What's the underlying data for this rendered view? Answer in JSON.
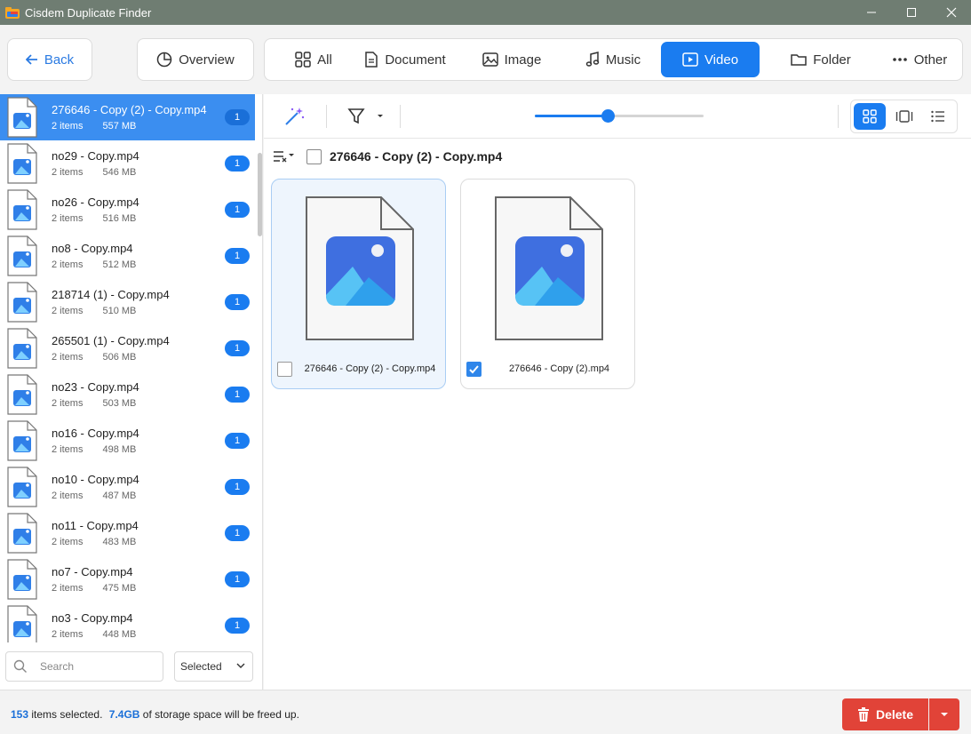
{
  "window": {
    "title": "Cisdem Duplicate Finder"
  },
  "nav": {
    "back_label": "Back",
    "overview_label": "Overview",
    "tabs": [
      {
        "label": "All",
        "icon": "grid-icon"
      },
      {
        "label": "Document",
        "icon": "document-icon"
      },
      {
        "label": "Image",
        "icon": "image-icon"
      },
      {
        "label": "Music",
        "icon": "music-note-icon"
      },
      {
        "label": "Video",
        "icon": "video-icon",
        "active": true
      },
      {
        "label": "Folder",
        "icon": "folder-icon"
      },
      {
        "label": "Other",
        "icon": "more-dots-icon"
      }
    ]
  },
  "sidebar": {
    "items": [
      {
        "name": "276646 - Copy (2) - Copy.mp4",
        "count_text": "2 items",
        "size": "557 MB",
        "badge": "1",
        "selected": true
      },
      {
        "name": "no29 - Copy.mp4",
        "count_text": "2 items",
        "size": "546 MB",
        "badge": "1"
      },
      {
        "name": "no26 - Copy.mp4",
        "count_text": "2 items",
        "size": "516 MB",
        "badge": "1"
      },
      {
        "name": "no8 - Copy.mp4",
        "count_text": "2 items",
        "size": "512 MB",
        "badge": "1"
      },
      {
        "name": "218714 (1) - Copy.mp4",
        "count_text": "2 items",
        "size": "510 MB",
        "badge": "1"
      },
      {
        "name": "265501 (1) - Copy.mp4",
        "count_text": "2 items",
        "size": "506 MB",
        "badge": "1"
      },
      {
        "name": "no23 - Copy.mp4",
        "count_text": "2 items",
        "size": "503 MB",
        "badge": "1"
      },
      {
        "name": "no16 - Copy.mp4",
        "count_text": "2 items",
        "size": "498 MB",
        "badge": "1"
      },
      {
        "name": "no10 - Copy.mp4",
        "count_text": "2 items",
        "size": "487 MB",
        "badge": "1"
      },
      {
        "name": "no11 - Copy.mp4",
        "count_text": "2 items",
        "size": "483 MB",
        "badge": "1"
      },
      {
        "name": "no7 - Copy.mp4",
        "count_text": "2 items",
        "size": "475 MB",
        "badge": "1"
      },
      {
        "name": "no3 - Copy.mp4",
        "count_text": "2 items",
        "size": "448 MB",
        "badge": "1"
      }
    ],
    "search_placeholder": "Search",
    "filter_value": "Selected"
  },
  "toolbar": {
    "zoom_fraction": 0.43
  },
  "group": {
    "title": "276646 - Copy (2) - Copy.mp4",
    "files": [
      {
        "name": "276646 - Copy (2) - Copy.mp4",
        "checked": false,
        "highlighted": true
      },
      {
        "name": "276646 - Copy (2).mp4",
        "checked": true,
        "highlighted": false
      }
    ]
  },
  "footer": {
    "selected_count": "153",
    "items_text": "items selected.",
    "space": "7.4GB",
    "space_text": "of storage space will be freed up.",
    "delete_label": "Delete"
  },
  "colors": {
    "accent": "#1a7cf0",
    "delete": "#e14338",
    "titlebar": "#6f7d72"
  }
}
